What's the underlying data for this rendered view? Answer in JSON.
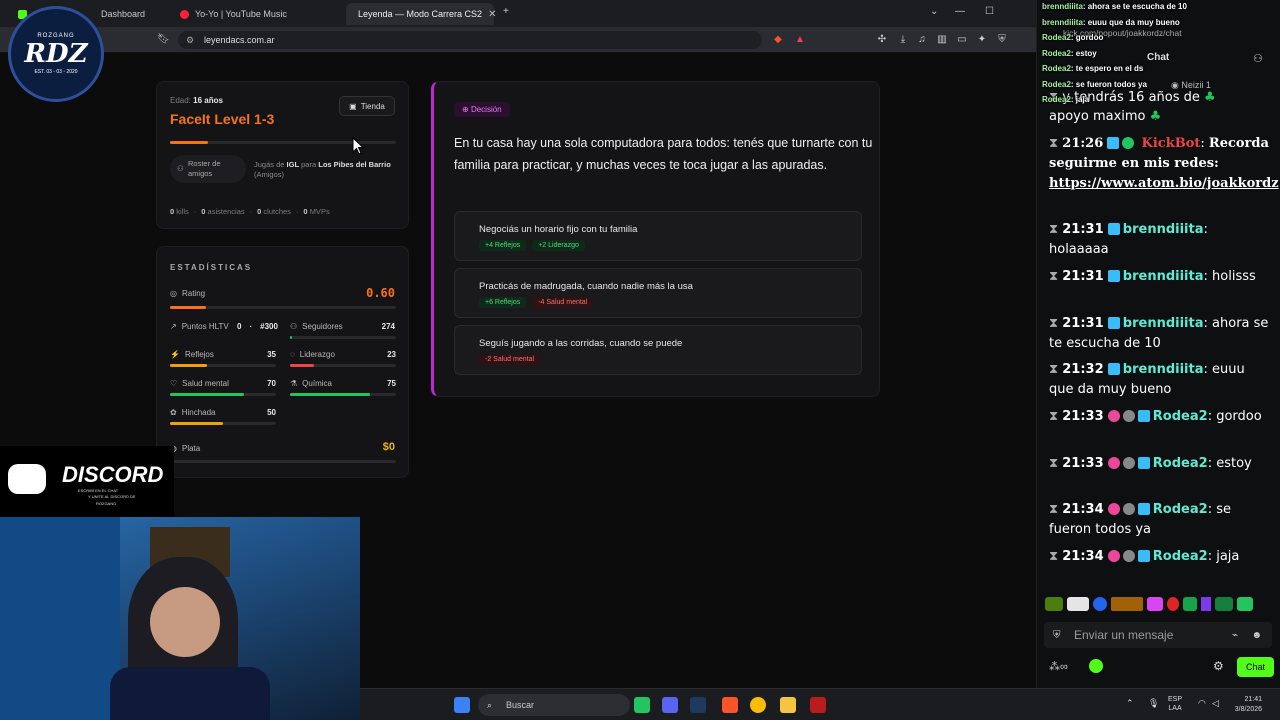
{
  "browser": {
    "tabs": [
      {
        "label": "Dashboard"
      },
      {
        "label": "Yo-Yo | YouTube Music"
      },
      {
        "label": "Leyenda — Modo Carrera CS2"
      }
    ],
    "url": "leyendacs.com.ar"
  },
  "profile": {
    "age_label": "Edad:",
    "age_value": "16 años",
    "rank": "FaceIt Level 1-3",
    "shop_button": "Tienda",
    "roster_button": "Roster de amigos",
    "role_prefix": "Jugás de",
    "role": "IGL",
    "team_prefix": "para",
    "team": "Los Pibes del Barrio",
    "team_suffix": "(Amigos)",
    "counters": [
      {
        "value": "0",
        "label": "kills"
      },
      {
        "value": "0",
        "label": "asistencias"
      },
      {
        "value": "0",
        "label": "clutches"
      },
      {
        "value": "0",
        "label": "MVPs"
      }
    ]
  },
  "stats": {
    "title": "ESTADÍSTICAS",
    "rating_label": "Rating",
    "rating_value": "0.60",
    "hltv_label": "Puntos HLTV",
    "hltv_value": "0",
    "hltv_rank": "#300",
    "followers_label": "Seguidores",
    "followers_value": "274",
    "items": [
      {
        "label": "Reflejos",
        "value": "35",
        "pct": 35,
        "color": "#f59e0b"
      },
      {
        "label": "Liderazgo",
        "value": "23",
        "pct": 23,
        "color": "#ef4444"
      },
      {
        "label": "Salud mental",
        "value": "70",
        "pct": 70,
        "color": "#22c55e"
      },
      {
        "label": "Química",
        "value": "75",
        "pct": 75,
        "color": "#22c55e"
      },
      {
        "label": "Hinchada",
        "value": "50",
        "pct": 50,
        "color": "#f59e0b"
      }
    ],
    "money_label": "Plata",
    "money_value": "$0"
  },
  "decision": {
    "tag": "Decisión",
    "text": "En tu casa hay una sola computadora para todos: tenés que turnarte con tu familia para practicar, y muchas veces te toca jugar a las apuradas.",
    "options": [
      {
        "text": "Negociás un horario fijo con tu familia",
        "effects": [
          {
            "t": "+4 Reflejos",
            "k": "pos"
          },
          {
            "t": "+2 Liderazgo",
            "k": "pos"
          }
        ]
      },
      {
        "text": "Practicás de madrugada, cuando nadie más la usa",
        "effects": [
          {
            "t": "+6 Reflejos",
            "k": "pos"
          },
          {
            "t": "-4 Salud mental",
            "k": "neg"
          }
        ]
      },
      {
        "text": "Seguís jugando a las corridas, cuando se puede",
        "effects": [
          {
            "t": "-2 Salud mental",
            "k": "neg"
          }
        ]
      }
    ]
  },
  "overlay_chat": [
    {
      "user": "brenndiiita",
      "msg": ": ahora se te escucha de 10"
    },
    {
      "user": "brenndiiita",
      "msg": ": euuu que da muy bueno"
    },
    {
      "user": "Rodea2",
      "msg": ": gordoo"
    },
    {
      "user": "Rodea2",
      "msg": ": estoy"
    },
    {
      "user": "Rodea2",
      "msg": ": te espero en el ds"
    },
    {
      "user": "Rodea2",
      "msg": ": se fueron todos ya"
    },
    {
      "user": "Rodea2",
      "msg": ": jaja"
    }
  ],
  "chat": {
    "header": "Chat",
    "popout_url": "kick.com/popout/joakkordz/chat",
    "viewer": "Neizii",
    "viewer_count": "1",
    "top_partial": "y tendrás 16 años de",
    "top_partial2": "apoyo maximo",
    "bot_time": "21:26",
    "bot_user": "KickBot",
    "bot_msg": "Recorda seguirme en mis redes:",
    "bot_link": "https://www.atom.bio/joakkordz",
    "messages": [
      {
        "time": "21:31",
        "user": "brenndiiita",
        "msg": "holaaaaa",
        "color": "#5eead4"
      },
      {
        "time": "21:31",
        "user": "brenndiiita",
        "msg": "holisss",
        "color": "#5eead4"
      },
      {
        "time": "21:31",
        "user": "brenndiiita",
        "msg": "ahora se te escucha de 10",
        "color": "#5eead4"
      },
      {
        "time": "21:32",
        "user": "brenndiiita",
        "msg": "euuu que da muy bueno",
        "color": "#5eead4"
      },
      {
        "time": "21:33",
        "user": "Rodea2",
        "msg": "gordoo",
        "color": "#5eead4"
      },
      {
        "time": "21:33",
        "user": "Rodea2",
        "msg": "estoy",
        "color": "#5eead4"
      },
      {
        "time": "21:34",
        "user": "Rodea2",
        "msg": "se fueron todos ya",
        "color": "#5eead4"
      },
      {
        "time": "21:34",
        "user": "Rodea2",
        "msg": "jaja",
        "color": "#5eead4"
      }
    ],
    "input_placeholder": "Enviar un mensaje",
    "send_label": "Chat"
  },
  "overlay": {
    "logo_top": "ROZGANG",
    "logo_main": "RDZ",
    "logo_date": "EST. 03 - 03 - 2020",
    "discord_title": "DISCORD",
    "discord_sub": "ESCRIBÍ EN EL CHAT",
    "discord_sub2": "Y UNITE AL DISCORD DE",
    "discord_sub3": "ROZGANG"
  },
  "taskbar": {
    "search": "Buscar",
    "lang": "ESP",
    "lang2": "LAA",
    "time": "21:41",
    "date": "3/8/2026"
  }
}
